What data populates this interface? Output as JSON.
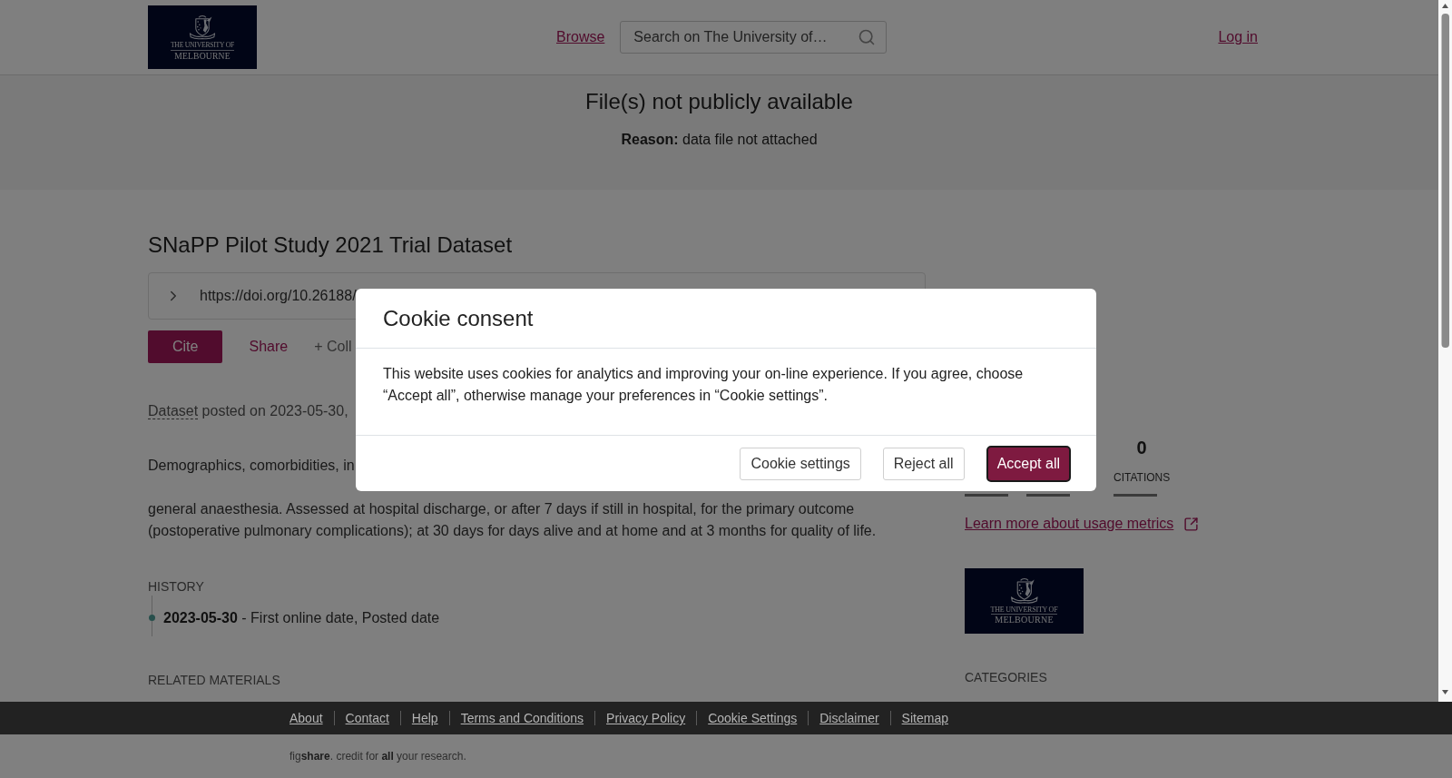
{
  "header": {
    "logo": {
      "line_1": "THE UNIVERSITY OF",
      "line_2": "MELBOURNE"
    },
    "nav_link": "Browse",
    "search": {
      "placeholder": "Search on The University of…"
    },
    "login_link": "Log in"
  },
  "notice": {
    "title": "File(s) not publicly available",
    "reason": "**Reason:** data file not attached"
  },
  "item": {
    "title": "SNaPP Pilot Study 2021 Trial Dataset",
    "doi": {
      "text": "https://doi.org/10.26188/",
      "expanded": false
    },
    "actions": [
      {
        "kind": "primary",
        "label": "Cite"
      },
      {
        "kind": "link",
        "label": "Share"
      },
      {
        "kind": "muted",
        "label": "+ Coll"
      }
    ],
    "posted": {
      "type_link": "Dataset",
      "text": "posted on 2023-05-30,"
    },
    "description": {
      "first_line": "Demographics, comorbidities, in",
      "last_lines": [
        "general anaesthesia. Assessed at hospital discharge, or after 7 days if still in hospital, for the primary outcome",
        "(postoperative pulmonary complications); at 30 days for days alive and at home and at 3 months for quality of life."
      ]
    },
    "history": {
      "heading": "HISTORY",
      "events": [
        "**2023-05-30** - First online date, Posted date"
      ]
    },
    "related_heading": "RELATED MATERIALS"
  },
  "sidebar": {
    "metrics": [
      {
        "kind": "covered"
      },
      {
        "kind": "covered"
      },
      {
        "kind": "count",
        "value": "0",
        "label": "CITATIONS"
      }
    ],
    "metrics_link": "Learn more about usage metrics",
    "logo": {
      "line_1": "THE UNIVERSITY OF",
      "line_2": "MELBOURNE"
    },
    "categories_heading": "CATEGORIES"
  },
  "footer": {
    "links": [
      "About",
      "Contact",
      "Help",
      "Terms and Conditions",
      "Privacy Policy",
      "Cookie Settings",
      "Disclaimer",
      "Sitemap"
    ],
    "credit": "fig**share**. credit for **all** your research."
  },
  "cookie_dialog": {
    "title": "Cookie consent",
    "body": "This website uses cookies for analytics and improving your on-line experience. If you agree, choose “Accept all”, otherwise manage your preferences in “Cookie settings”.",
    "buttons": [
      {
        "kind": "secondary",
        "label": "Cookie settings",
        "focused": false
      },
      {
        "kind": "secondary",
        "label": "Reject all",
        "focused": false
      },
      {
        "kind": "primary",
        "label": "Accept all",
        "focused": true
      }
    ]
  }
}
